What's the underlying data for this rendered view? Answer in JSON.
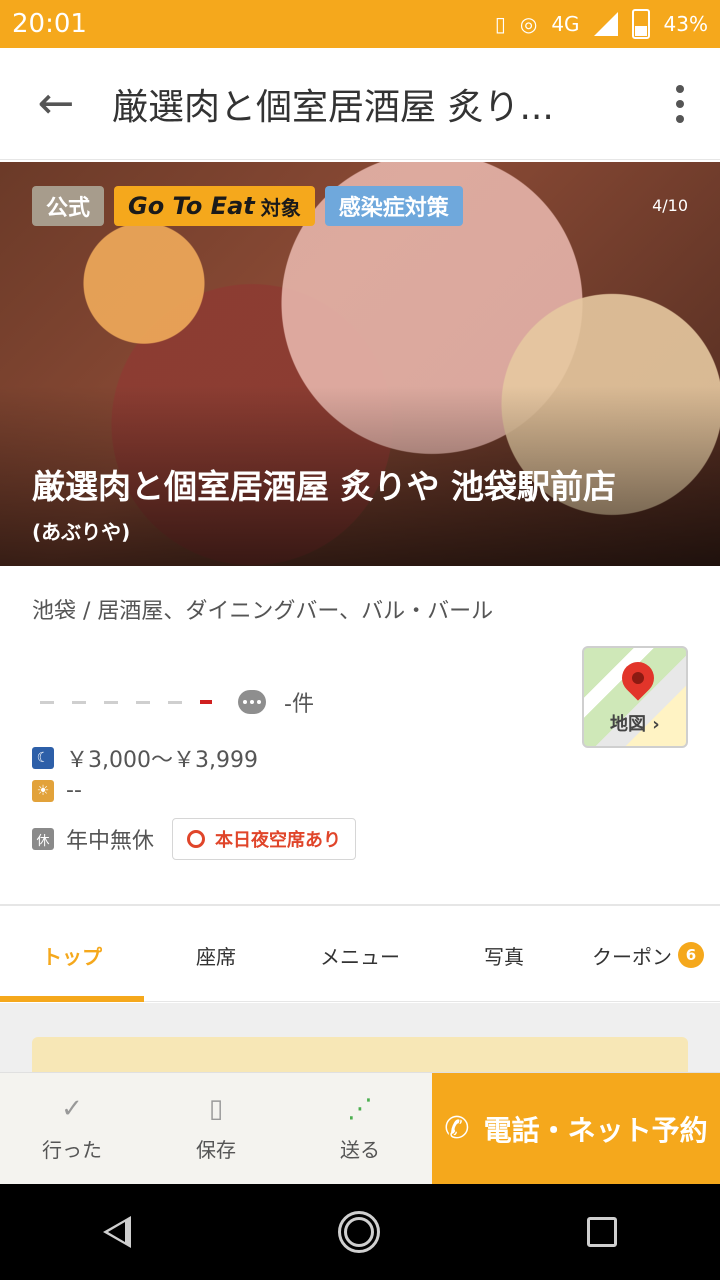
{
  "status": {
    "time": "20:01",
    "network": "4G",
    "battery": "43%"
  },
  "header": {
    "title": "厳選肉と個室居酒屋 炙り..."
  },
  "hero": {
    "badges": {
      "official": "公式",
      "gotoeat_main": "Go To Eat",
      "gotoeat_sub": "対象",
      "infection": "感染症対策"
    },
    "photo_counter": "4/10",
    "title": "厳選肉と個室居酒屋 炙りや 池袋駅前店",
    "reading": "(あぶりや)"
  },
  "info": {
    "genre": "池袋 / 居酒屋、ダイニングバー、バル・バール",
    "review_count": "-件",
    "dinner_price": "￥3,000～￥3,999",
    "lunch_price": "--",
    "holiday_icon": "休",
    "holiday": "年中無休",
    "vacancy": "本日夜空席あり",
    "map_label": "地図 ›"
  },
  "tabs": [
    {
      "label": "トップ"
    },
    {
      "label": "座席"
    },
    {
      "label": "メニュー"
    },
    {
      "label": "写真"
    },
    {
      "label": "クーポン",
      "badge": "6"
    }
  ],
  "actions": {
    "visited": "行った",
    "save": "保存",
    "share": "送る",
    "reserve": "電話・ネット予約"
  },
  "colors": {
    "accent": "#f5a81c",
    "vacancy": "#e0452a",
    "infection_badge": "#6fa8dc"
  }
}
